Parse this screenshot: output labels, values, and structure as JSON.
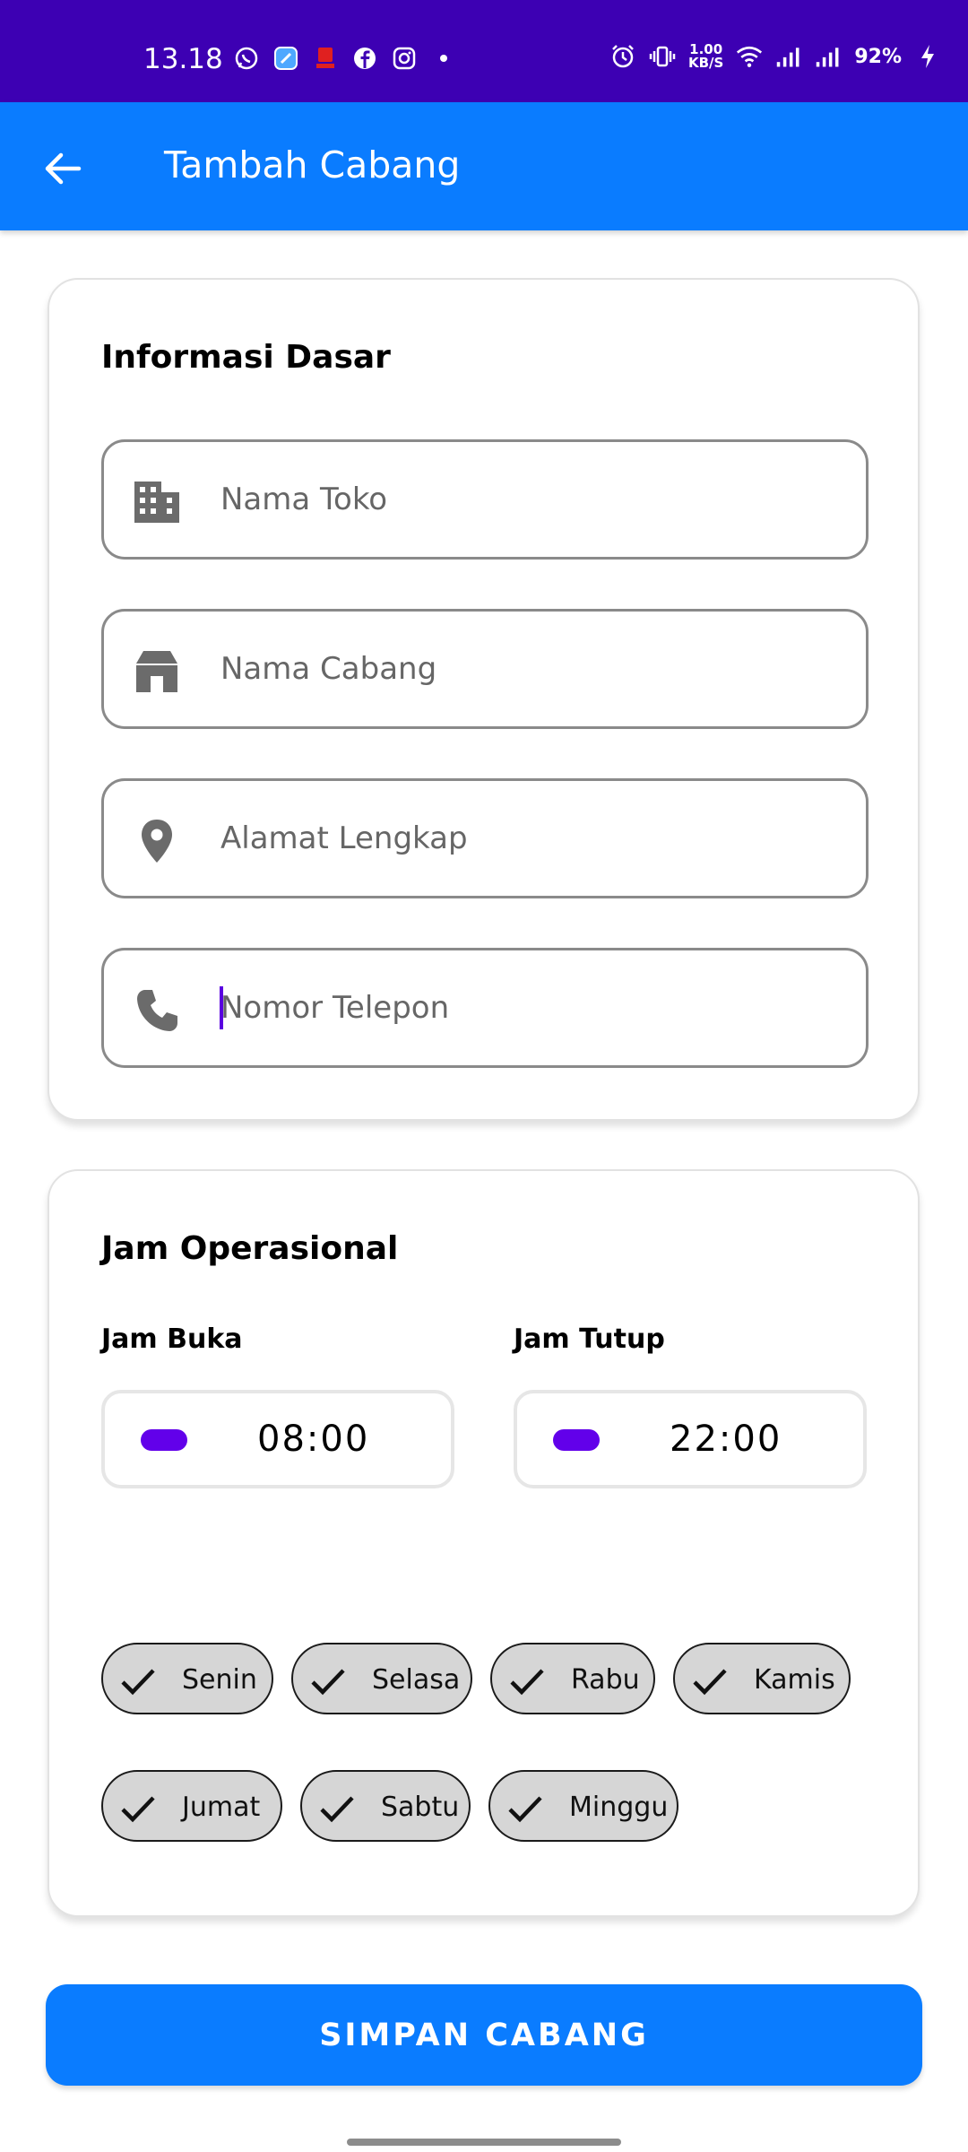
{
  "status_bar": {
    "time": "13.18",
    "net_speed_top": "1.00",
    "net_speed_bottom": "KB/S",
    "battery": "92%",
    "left_icons": [
      "whatsapp-icon",
      "app-icon",
      "pay-icon",
      "facebook-icon",
      "instagram-icon",
      "dot-icon"
    ],
    "right_icons": [
      "alarm-icon",
      "vibrate-icon",
      "wifi-icon",
      "signal-icon",
      "signal-icon",
      "charging-icon"
    ]
  },
  "app_bar": {
    "title": "Tambah Cabang",
    "back_icon": "arrow-back-icon"
  },
  "basic_info": {
    "title": "Informasi Dasar",
    "fields": [
      {
        "placeholder": "Nama Toko",
        "icon": "building-icon"
      },
      {
        "placeholder": "Nama Cabang",
        "icon": "store-icon"
      },
      {
        "placeholder": "Alamat Lengkap",
        "icon": "location-pin-icon"
      },
      {
        "placeholder": "Nomor Telepon",
        "icon": "phone-icon"
      }
    ]
  },
  "hours": {
    "title": "Jam Operasional",
    "open_label": "Jam Buka",
    "open_value": "08:00",
    "close_label": "Jam Tutup",
    "close_value": "22:00",
    "days": [
      {
        "label": "Senin",
        "checked": true
      },
      {
        "label": "Selasa",
        "checked": true
      },
      {
        "label": "Rabu",
        "checked": true
      },
      {
        "label": "Kamis",
        "checked": true
      },
      {
        "label": "Jumat",
        "checked": true
      },
      {
        "label": "Sabtu",
        "checked": true
      },
      {
        "label": "Minggu",
        "checked": true
      }
    ]
  },
  "save_button": {
    "label": "SIMPAN CABANG"
  },
  "colors": {
    "status_bar": "#3d00b3",
    "primary": "#0a7cff",
    "accent": "#6200ea",
    "chip_bg": "#d6d6d6"
  }
}
